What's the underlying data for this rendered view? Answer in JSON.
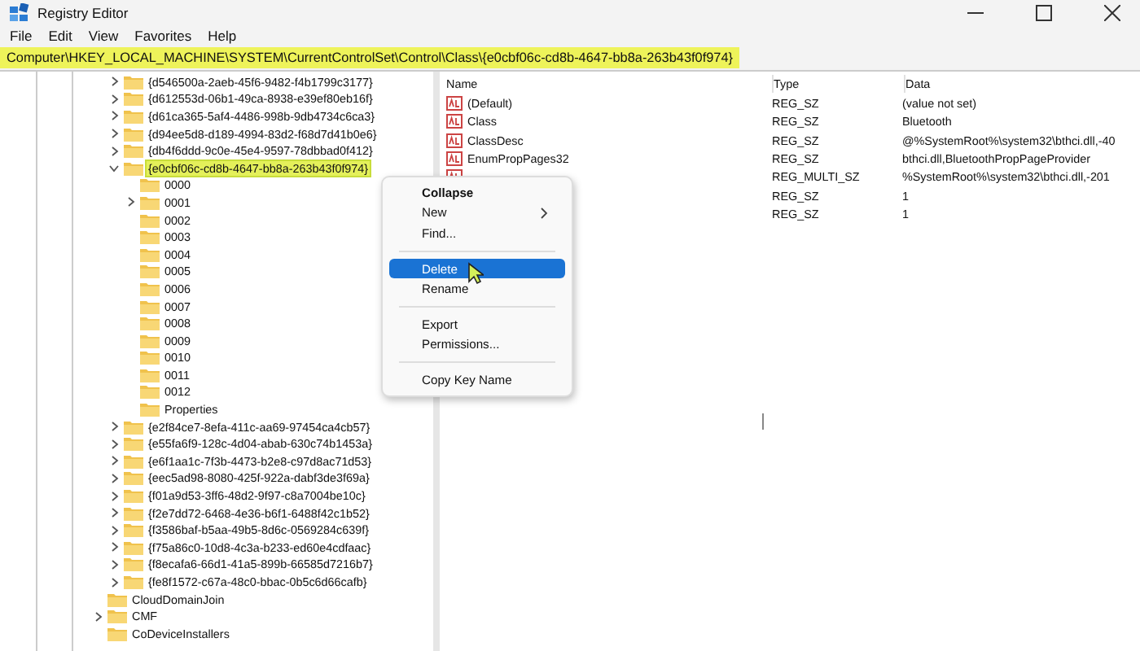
{
  "window": {
    "title": "Registry Editor"
  },
  "menu_bar": [
    "File",
    "Edit",
    "View",
    "Favorites",
    "Help"
  ],
  "address_bar": {
    "value": "Computer\\HKEY_LOCAL_MACHINE\\SYSTEM\\CurrentControlSet\\Control\\Class\\{e0cbf06c-cd8b-4647-bb8a-263b43f0f974}",
    "highlighted": true
  },
  "tree": [
    {
      "children": [
        {
          "label": "{d546500a-2aeb-45f6-9482-f4b1799c3177}",
          "kind": "branch",
          "expanded": false,
          "selected": false
        },
        {
          "label": "{d612553d-06b1-49ca-8938-e39ef80eb16f}",
          "kind": "branch",
          "expanded": false,
          "selected": false
        },
        {
          "label": "{d61ca365-5af4-4486-998b-9db4734c6ca3}",
          "kind": "branch",
          "expanded": false,
          "selected": false
        },
        {
          "label": "{d94ee5d8-d189-4994-83d2-f68d7d41b0e6}",
          "kind": "branch",
          "expanded": false,
          "selected": false
        },
        {
          "label": "{db4f6ddd-9c0e-45e4-9597-78dbbad0f412}",
          "kind": "branch",
          "expanded": false,
          "selected": false
        },
        {
          "label": "{e0cbf06c-cd8b-4647-bb8a-263b43f0f974}",
          "kind": "branch",
          "expanded": true,
          "selected": true,
          "children": [
            {
              "label": "0000",
              "kind": "leaf",
              "selected": false
            },
            {
              "label": "0001",
              "kind": "branch",
              "expanded": false,
              "selected": false
            },
            {
              "label": "0002",
              "kind": "leaf",
              "selected": false
            },
            {
              "label": "0003",
              "kind": "leaf",
              "selected": false
            },
            {
              "label": "0004",
              "kind": "leaf",
              "selected": false
            },
            {
              "label": "0005",
              "kind": "leaf",
              "selected": false
            },
            {
              "label": "0006",
              "kind": "leaf",
              "selected": false
            },
            {
              "label": "0007",
              "kind": "leaf",
              "selected": false
            },
            {
              "label": "0008",
              "kind": "leaf",
              "selected": false
            },
            {
              "label": "0009",
              "kind": "leaf",
              "selected": false
            },
            {
              "label": "0010",
              "kind": "leaf",
              "selected": false
            },
            {
              "label": "0011",
              "kind": "leaf",
              "selected": false
            },
            {
              "label": "0012",
              "kind": "leaf",
              "selected": false
            },
            {
              "label": "Properties",
              "kind": "leaf",
              "selected": false
            }
          ]
        },
        {
          "label": "{e2f84ce7-8efa-411c-aa69-97454ca4cb57}",
          "kind": "branch",
          "expanded": false,
          "selected": false
        },
        {
          "label": "{e55fa6f9-128c-4d04-abab-630c74b1453a}",
          "kind": "branch",
          "expanded": false,
          "selected": false
        },
        {
          "label": "{e6f1aa1c-7f3b-4473-b2e8-c97d8ac71d53}",
          "kind": "branch",
          "expanded": false,
          "selected": false
        },
        {
          "label": "{eec5ad98-8080-425f-922a-dabf3de3f69a}",
          "kind": "branch",
          "expanded": false,
          "selected": false
        },
        {
          "label": "{f01a9d53-3ff6-48d2-9f97-c8a7004be10c}",
          "kind": "branch",
          "expanded": false,
          "selected": false
        },
        {
          "label": "{f2e7dd72-6468-4e36-b6f1-6488f42c1b52}",
          "kind": "branch",
          "expanded": false,
          "selected": false
        },
        {
          "label": "{f3586baf-b5aa-49b5-8d6c-0569284c639f}",
          "kind": "branch",
          "expanded": false,
          "selected": false
        },
        {
          "label": "{f75a86c0-10d8-4c3a-b233-ed60e4cdfaac}",
          "kind": "branch",
          "expanded": false,
          "selected": false
        },
        {
          "label": "{f8ecafa6-66d1-41a5-899b-66585d7216b7}",
          "kind": "branch",
          "expanded": false,
          "selected": false
        },
        {
          "label": "{fe8f1572-c67a-48c0-bbac-0b5c6d66cafb}",
          "kind": "branch",
          "expanded": false,
          "selected": false
        }
      ]
    },
    {
      "label": "CloudDomainJoin",
      "kind": "leaf",
      "selected": false
    },
    {
      "label": "CMF",
      "kind": "branch",
      "expanded": false,
      "selected": false
    },
    {
      "label": "CoDeviceInstallers",
      "kind": "leaf",
      "selected": false
    }
  ],
  "values_table": {
    "columns": [
      "Name",
      "Type",
      "Data"
    ],
    "rows": [
      {
        "name": "(Default)",
        "type": "REG_SZ",
        "data": "(value not set)"
      },
      {
        "name": "Class",
        "type": "REG_SZ",
        "data": "Bluetooth"
      },
      {
        "name": "ClassDesc",
        "type": "REG_SZ",
        "data": "@%SystemRoot%\\system32\\bthci.dll,-40"
      },
      {
        "name": "EnumPropPages32",
        "type": "REG_SZ",
        "data": "bthci.dll,BluetoothPropPageProvider"
      },
      {
        "type": "REG_MULTI_SZ",
        "data": "%SystemRoot%\\system32\\bthci.dll,-201"
      },
      {
        "type": "REG_SZ",
        "data": "1"
      },
      {
        "type": "REG_SZ",
        "data": "1"
      }
    ]
  },
  "context_menu": [
    {
      "kind": "item",
      "label": "Collapse",
      "default": true,
      "submenu": false,
      "selected": false
    },
    {
      "kind": "item",
      "label": "New",
      "default": false,
      "submenu": true,
      "selected": false
    },
    {
      "kind": "item",
      "label": "Find...",
      "default": false,
      "submenu": false,
      "selected": false
    },
    {
      "kind": "separator"
    },
    {
      "kind": "item",
      "label": "Delete",
      "default": false,
      "submenu": false,
      "selected": true
    },
    {
      "kind": "item",
      "label": "Rename",
      "default": false,
      "submenu": false,
      "selected": false
    },
    {
      "kind": "separator"
    },
    {
      "kind": "item",
      "label": "Export",
      "default": false,
      "submenu": false,
      "selected": false
    },
    {
      "kind": "item",
      "label": "Permissions...",
      "default": false,
      "submenu": false,
      "selected": false
    },
    {
      "kind": "separator"
    },
    {
      "kind": "item",
      "label": "Copy Key Name",
      "default": false,
      "submenu": false,
      "selected": false
    }
  ]
}
